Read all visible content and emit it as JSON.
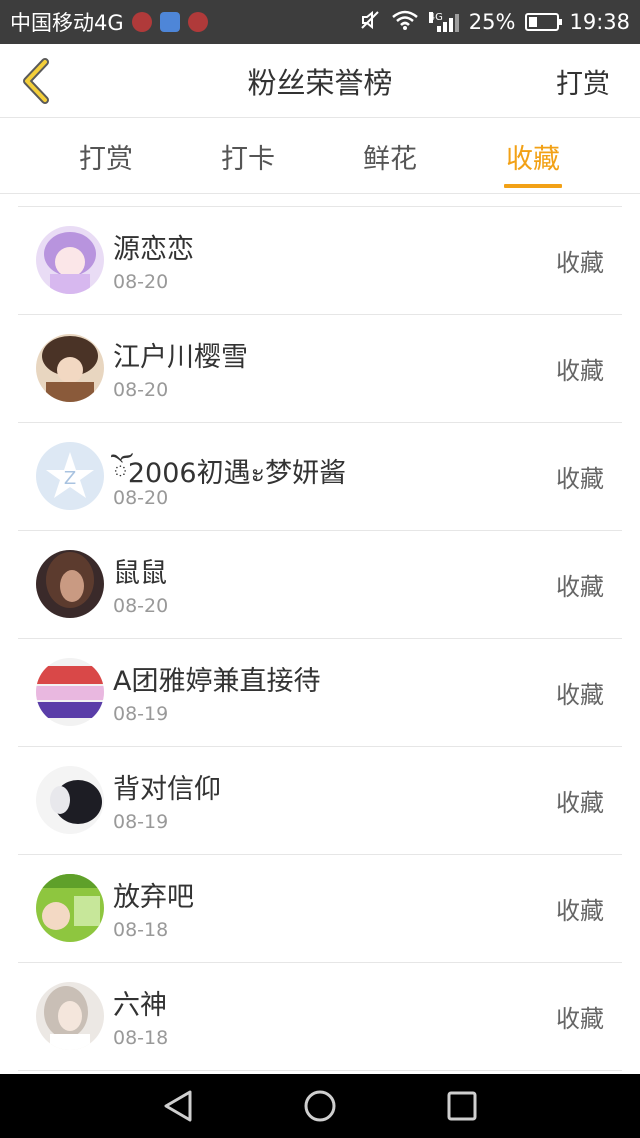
{
  "status_bar": {
    "carrier": "中国移动4G",
    "network_type": "4G",
    "battery": "25%",
    "time": "19:38"
  },
  "header": {
    "title": "粉丝荣誉榜",
    "action_label": "打赏",
    "back_icon": "chevron-left-icon",
    "accent_color": "#f2a116"
  },
  "tabs": [
    {
      "label": "打赏",
      "active": false
    },
    {
      "label": "打卡",
      "active": false
    },
    {
      "label": "鲜花",
      "active": false
    },
    {
      "label": "收藏",
      "active": true
    }
  ],
  "list": [
    {
      "name": "源恋恋",
      "date": "08-20",
      "action": "收藏"
    },
    {
      "name": "江户川樱雪",
      "date": "08-20",
      "action": "收藏"
    },
    {
      "name": "ོ2006初遇ะ梦妍酱",
      "date": "08-20",
      "action": "收藏"
    },
    {
      "name": "鼠鼠",
      "date": "08-20",
      "action": "收藏"
    },
    {
      "name": "A团雅婷兼直接待",
      "date": "08-19",
      "action": "收藏"
    },
    {
      "name": "背对信仰",
      "date": "08-19",
      "action": "收藏"
    },
    {
      "name": "放弃吧",
      "date": "08-18",
      "action": "收藏"
    },
    {
      "name": "六神",
      "date": "08-18",
      "action": "收藏"
    }
  ],
  "nav_bar": {
    "back": "triangle-back-icon",
    "home": "circle-home-icon",
    "recents": "square-recents-icon"
  }
}
